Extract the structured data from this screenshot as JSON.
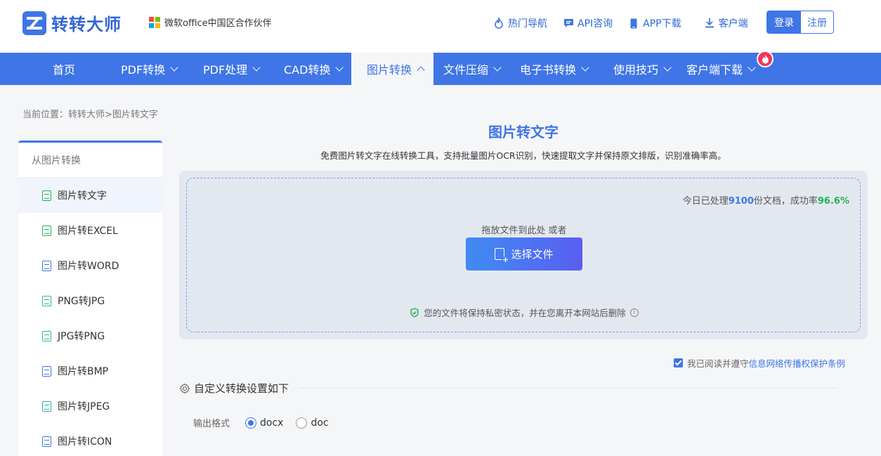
{
  "header": {
    "brand": "转转大师",
    "partner": "微软office中国区合作伙伴",
    "links": [
      {
        "label": "热门导航",
        "icon": "flame-icon"
      },
      {
        "label": "API咨询",
        "icon": "chat-icon"
      },
      {
        "label": "APP下载",
        "icon": "phone-icon"
      },
      {
        "label": "客户端",
        "icon": "download-icon"
      }
    ],
    "login": "登录",
    "register": "注册"
  },
  "nav": {
    "items": [
      {
        "label": "首页",
        "dropdown": false
      },
      {
        "label": "PDF转换",
        "dropdown": true
      },
      {
        "label": "PDF处理",
        "dropdown": true
      },
      {
        "label": "CAD转换",
        "dropdown": true
      },
      {
        "label": "图片转换",
        "dropdown": true,
        "active": true
      },
      {
        "label": "文件压缩",
        "dropdown": true
      },
      {
        "label": "电子书转换",
        "dropdown": true
      },
      {
        "label": "使用技巧",
        "dropdown": true
      },
      {
        "label": "客户端下载",
        "dropdown": true
      }
    ]
  },
  "breadcrumb": "当前位置：转转大师>图片转文字",
  "sidebar": {
    "heading": "从图片转换",
    "items": [
      {
        "label": "图片转文字",
        "active": true,
        "color": "#21b24f"
      },
      {
        "label": "图片转EXCEL",
        "color": "#21b24f"
      },
      {
        "label": "图片转WORD",
        "color": "#3f75e6"
      },
      {
        "label": "PNG转JPG",
        "color": "#2bb3a0"
      },
      {
        "label": "JPG转PNG",
        "color": "#2bb3a0"
      },
      {
        "label": "图片转BMP",
        "color": "#3f75e6"
      },
      {
        "label": "图片转JPEG",
        "color": "#2bb3a0"
      },
      {
        "label": "图片转ICON",
        "color": "#3f75e6"
      }
    ]
  },
  "main": {
    "title": "图片转文字",
    "subtitle": "免费图片转文字在线转换工具，支持批量图片OCR识别，快速提取文字并保持原文排版，识别准确率高。",
    "stats": {
      "prefix": "今日已处理",
      "count": "9100",
      "middle": "份文档，成功率",
      "rate": "96.6%"
    },
    "drop_text": "拖放文件到此处 或者",
    "choose_button": "选择文件",
    "privacy": "您的文件将保持私密状态，并在您离开本网站后删除",
    "agree_prefix": "我已阅读并遵守",
    "agree_link": "信息网络传播权保护条例",
    "settings_title": "自定义转换设置如下",
    "format_label": "输出格式",
    "formats": [
      {
        "label": "docx",
        "checked": true
      },
      {
        "label": "doc",
        "checked": false
      }
    ]
  },
  "colors": {
    "primary": "#3f75e6",
    "success": "#21b24f",
    "hot": "#f0365f"
  }
}
